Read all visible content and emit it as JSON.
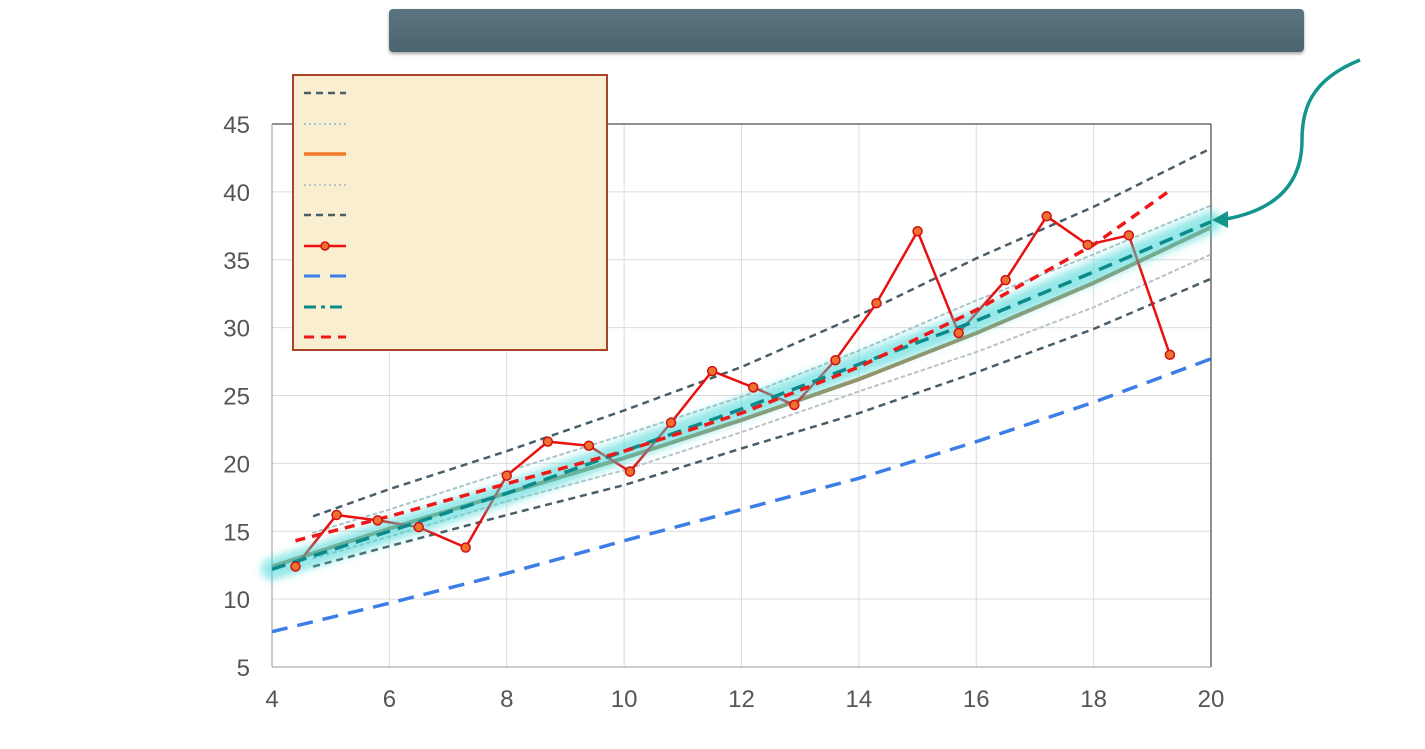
{
  "title": "",
  "chart_data": {
    "type": "line",
    "title": "",
    "xlabel": "",
    "ylabel": "",
    "xlim": [
      4,
      20
    ],
    "ylim": [
      5,
      45
    ],
    "xticks": [
      4,
      6,
      8,
      10,
      12,
      14,
      16,
      18,
      20
    ],
    "yticks": [
      5,
      10,
      15,
      20,
      25,
      30,
      35,
      40,
      45
    ],
    "grid": true,
    "legend_position": "top-left",
    "series": [
      {
        "style": "dashed",
        "color": "#4a5e6a",
        "width": 2.5,
        "dash": "7,5",
        "x": [
          4.7,
          6,
          8,
          10,
          12,
          14,
          16,
          18,
          20
        ],
        "y": [
          16.1,
          18.1,
          20.9,
          23.9,
          27.1,
          30.9,
          35.1,
          38.9,
          43.2
        ]
      },
      {
        "style": "dotted",
        "color": "#a9c4cc",
        "width": 2,
        "dash": "3,4",
        "x": [
          4.7,
          6,
          8,
          10,
          12,
          14,
          16,
          18,
          20
        ],
        "y": [
          14.9,
          16.6,
          19.4,
          22.1,
          24.9,
          28.3,
          32.0,
          35.4,
          39.0
        ]
      },
      {
        "style": "solid",
        "color": "#a08a5a",
        "width": 4,
        "dash": "",
        "x": [
          4,
          6,
          8,
          10,
          12,
          14,
          16,
          18,
          20
        ],
        "y": [
          12.4,
          15.2,
          17.8,
          20.4,
          23.2,
          26.2,
          29.6,
          33.3,
          37.4
        ]
      },
      {
        "style": "dotted",
        "color": "#b8c4c8",
        "width": 2,
        "dash": "3,4",
        "x": [
          4.7,
          6,
          8,
          10,
          12,
          14,
          16,
          18,
          20
        ],
        "y": [
          13.0,
          14.6,
          17.2,
          19.5,
          22.3,
          25.3,
          28.2,
          31.5,
          35.4
        ]
      },
      {
        "style": "dashed",
        "color": "#4a5e6a",
        "width": 2.5,
        "dash": "7,5",
        "x": [
          4.7,
          6,
          8,
          10,
          12,
          14,
          16,
          18,
          20
        ],
        "y": [
          12.4,
          13.9,
          16.2,
          18.4,
          21.1,
          23.7,
          26.7,
          29.9,
          33.6
        ]
      },
      {
        "style": "marker-line",
        "color": "#e81010",
        "width": 2.5,
        "dash": "",
        "x": [
          4.4,
          5.1,
          5.8,
          6.5,
          7.3,
          8.0,
          8.7,
          9.4,
          10.1,
          10.8,
          11.5,
          12.2,
          12.9,
          13.6,
          14.3,
          15.0,
          15.7,
          16.5,
          17.2,
          17.9,
          18.6,
          19.3
        ],
        "y": [
          12.4,
          16.2,
          15.8,
          15.3,
          13.8,
          19.1,
          21.6,
          21.3,
          19.4,
          23.0,
          26.8,
          25.6,
          24.3,
          27.6,
          31.8,
          37.1,
          29.6,
          33.5,
          38.2,
          36.1,
          36.8,
          28.0
        ]
      },
      {
        "style": "dashed",
        "color": "#3b7ee8",
        "width": 3.5,
        "dash": "16,10",
        "x": [
          4,
          6,
          8,
          10,
          12,
          14,
          16,
          18,
          20
        ],
        "y": [
          7.6,
          9.7,
          11.9,
          14.3,
          16.6,
          18.9,
          21.6,
          24.5,
          27.7
        ]
      },
      {
        "style": "dash-glow",
        "color": "#0a8a8a",
        "width": 3.5,
        "dash": "14,8",
        "x": [
          4,
          6,
          8,
          10,
          12,
          14,
          16,
          18,
          20
        ],
        "y": [
          12.2,
          15.0,
          17.8,
          20.9,
          24.0,
          27.3,
          30.5,
          34.1,
          37.8
        ]
      },
      {
        "style": "dashed",
        "color": "#ee1818",
        "width": 3.5,
        "dash": "10,7",
        "x": [
          4.4,
          6,
          8,
          10,
          12,
          14,
          16,
          18,
          19.3
        ],
        "y": [
          14.3,
          16.1,
          18.5,
          20.9,
          23.7,
          27.1,
          31.3,
          36.1,
          40.1
        ]
      }
    ]
  }
}
